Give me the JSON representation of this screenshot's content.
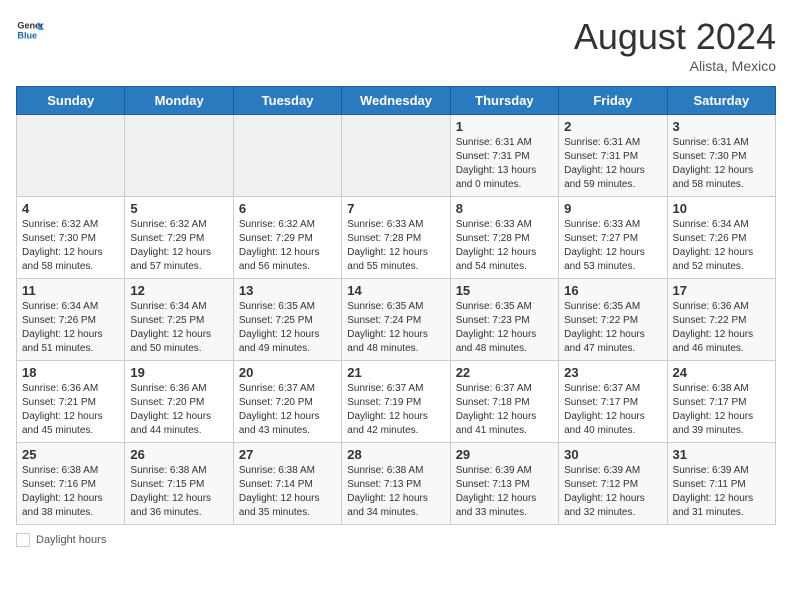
{
  "header": {
    "logo_general": "General",
    "logo_blue": "Blue",
    "month_year": "August 2024",
    "location": "Alista, Mexico"
  },
  "days_of_week": [
    "Sunday",
    "Monday",
    "Tuesday",
    "Wednesday",
    "Thursday",
    "Friday",
    "Saturday"
  ],
  "weeks": [
    [
      {
        "day": "",
        "info": ""
      },
      {
        "day": "",
        "info": ""
      },
      {
        "day": "",
        "info": ""
      },
      {
        "day": "",
        "info": ""
      },
      {
        "day": "1",
        "info": "Sunrise: 6:31 AM\nSunset: 7:31 PM\nDaylight: 13 hours and 0 minutes."
      },
      {
        "day": "2",
        "info": "Sunrise: 6:31 AM\nSunset: 7:31 PM\nDaylight: 12 hours and 59 minutes."
      },
      {
        "day": "3",
        "info": "Sunrise: 6:31 AM\nSunset: 7:30 PM\nDaylight: 12 hours and 58 minutes."
      }
    ],
    [
      {
        "day": "4",
        "info": "Sunrise: 6:32 AM\nSunset: 7:30 PM\nDaylight: 12 hours and 58 minutes."
      },
      {
        "day": "5",
        "info": "Sunrise: 6:32 AM\nSunset: 7:29 PM\nDaylight: 12 hours and 57 minutes."
      },
      {
        "day": "6",
        "info": "Sunrise: 6:32 AM\nSunset: 7:29 PM\nDaylight: 12 hours and 56 minutes."
      },
      {
        "day": "7",
        "info": "Sunrise: 6:33 AM\nSunset: 7:28 PM\nDaylight: 12 hours and 55 minutes."
      },
      {
        "day": "8",
        "info": "Sunrise: 6:33 AM\nSunset: 7:28 PM\nDaylight: 12 hours and 54 minutes."
      },
      {
        "day": "9",
        "info": "Sunrise: 6:33 AM\nSunset: 7:27 PM\nDaylight: 12 hours and 53 minutes."
      },
      {
        "day": "10",
        "info": "Sunrise: 6:34 AM\nSunset: 7:26 PM\nDaylight: 12 hours and 52 minutes."
      }
    ],
    [
      {
        "day": "11",
        "info": "Sunrise: 6:34 AM\nSunset: 7:26 PM\nDaylight: 12 hours and 51 minutes."
      },
      {
        "day": "12",
        "info": "Sunrise: 6:34 AM\nSunset: 7:25 PM\nDaylight: 12 hours and 50 minutes."
      },
      {
        "day": "13",
        "info": "Sunrise: 6:35 AM\nSunset: 7:25 PM\nDaylight: 12 hours and 49 minutes."
      },
      {
        "day": "14",
        "info": "Sunrise: 6:35 AM\nSunset: 7:24 PM\nDaylight: 12 hours and 48 minutes."
      },
      {
        "day": "15",
        "info": "Sunrise: 6:35 AM\nSunset: 7:23 PM\nDaylight: 12 hours and 48 minutes."
      },
      {
        "day": "16",
        "info": "Sunrise: 6:35 AM\nSunset: 7:22 PM\nDaylight: 12 hours and 47 minutes."
      },
      {
        "day": "17",
        "info": "Sunrise: 6:36 AM\nSunset: 7:22 PM\nDaylight: 12 hours and 46 minutes."
      }
    ],
    [
      {
        "day": "18",
        "info": "Sunrise: 6:36 AM\nSunset: 7:21 PM\nDaylight: 12 hours and 45 minutes."
      },
      {
        "day": "19",
        "info": "Sunrise: 6:36 AM\nSunset: 7:20 PM\nDaylight: 12 hours and 44 minutes."
      },
      {
        "day": "20",
        "info": "Sunrise: 6:37 AM\nSunset: 7:20 PM\nDaylight: 12 hours and 43 minutes."
      },
      {
        "day": "21",
        "info": "Sunrise: 6:37 AM\nSunset: 7:19 PM\nDaylight: 12 hours and 42 minutes."
      },
      {
        "day": "22",
        "info": "Sunrise: 6:37 AM\nSunset: 7:18 PM\nDaylight: 12 hours and 41 minutes."
      },
      {
        "day": "23",
        "info": "Sunrise: 6:37 AM\nSunset: 7:17 PM\nDaylight: 12 hours and 40 minutes."
      },
      {
        "day": "24",
        "info": "Sunrise: 6:38 AM\nSunset: 7:17 PM\nDaylight: 12 hours and 39 minutes."
      }
    ],
    [
      {
        "day": "25",
        "info": "Sunrise: 6:38 AM\nSunset: 7:16 PM\nDaylight: 12 hours and 38 minutes."
      },
      {
        "day": "26",
        "info": "Sunrise: 6:38 AM\nSunset: 7:15 PM\nDaylight: 12 hours and 36 minutes."
      },
      {
        "day": "27",
        "info": "Sunrise: 6:38 AM\nSunset: 7:14 PM\nDaylight: 12 hours and 35 minutes."
      },
      {
        "day": "28",
        "info": "Sunrise: 6:38 AM\nSunset: 7:13 PM\nDaylight: 12 hours and 34 minutes."
      },
      {
        "day": "29",
        "info": "Sunrise: 6:39 AM\nSunset: 7:13 PM\nDaylight: 12 hours and 33 minutes."
      },
      {
        "day": "30",
        "info": "Sunrise: 6:39 AM\nSunset: 7:12 PM\nDaylight: 12 hours and 32 minutes."
      },
      {
        "day": "31",
        "info": "Sunrise: 6:39 AM\nSunset: 7:11 PM\nDaylight: 12 hours and 31 minutes."
      }
    ]
  ],
  "footer": {
    "label": "Daylight hours"
  }
}
